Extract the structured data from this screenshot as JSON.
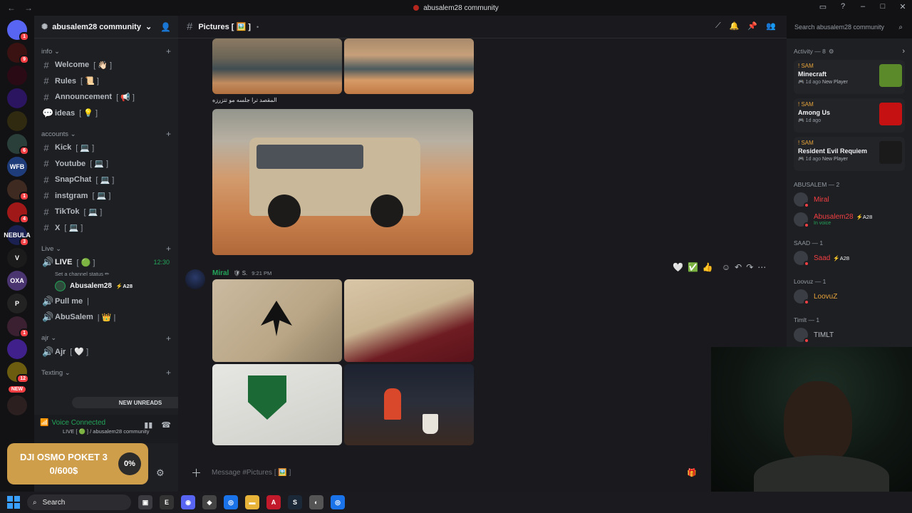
{
  "window": {
    "title": "abusalem28 community"
  },
  "server_list": {
    "new_label": "NEW",
    "servers": [
      {
        "letter": "",
        "color": "#5865f2",
        "badge": "1"
      },
      {
        "letter": "",
        "color": "#3a1212",
        "badge": "9"
      },
      {
        "letter": "",
        "color": "#2a0a14",
        "badge": ""
      },
      {
        "letter": "",
        "color": "#2b1460",
        "badge": ""
      },
      {
        "letter": "",
        "color": "#2f2a10",
        "badge": ""
      },
      {
        "letter": "",
        "color": "#2a3f3a",
        "badge": "6"
      },
      {
        "letter": "WFB",
        "color": "#1f3c7a",
        "badge": ""
      },
      {
        "letter": "",
        "color": "#3e2a20",
        "badge": "1"
      },
      {
        "letter": "",
        "color": "#a01818",
        "badge": "4"
      },
      {
        "letter": "NEBULA",
        "color": "#1a2050",
        "badge": "3"
      },
      {
        "letter": "V",
        "color": "#1b1b1b",
        "badge": ""
      },
      {
        "letter": "OXA",
        "color": "#4a3570",
        "badge": ""
      },
      {
        "letter": "P",
        "color": "#222",
        "badge": ""
      },
      {
        "letter": "",
        "color": "#3a2030",
        "badge": "1"
      },
      {
        "letter": "",
        "color": "#40208a",
        "badge": ""
      },
      {
        "letter": "",
        "color": "#6b5c10",
        "badge": "12"
      },
      {
        "letter": "",
        "color": "#2c1f1f",
        "badge": ""
      }
    ]
  },
  "guild": {
    "name": "abusalem28 community"
  },
  "categories": [
    {
      "name": "info",
      "channels": [
        {
          "name": "Welcome",
          "suffix": "[ 👋🏻 ]"
        },
        {
          "name": "Rules",
          "suffix": "[ 📜 ]"
        },
        {
          "name": "Announcement",
          "suffix": "[ 📢 ]"
        },
        {
          "name": "ideas",
          "suffix": "[ 💡 ]"
        }
      ]
    },
    {
      "name": "accounts",
      "channels": [
        {
          "name": "Kick",
          "suffix": "[ 💻 ]"
        },
        {
          "name": "Youtube",
          "suffix": "[ 💻 ]"
        },
        {
          "name": "SnapChat",
          "suffix": "[ 💻 ]"
        },
        {
          "name": "instgram",
          "suffix": "[ 💻 ]"
        },
        {
          "name": "TikTok",
          "suffix": "[ 💻 ]"
        },
        {
          "name": "X",
          "suffix": "[ 💻 ]"
        }
      ]
    }
  ],
  "live_category": {
    "name": "Live",
    "live_channel": {
      "name": "LIVE",
      "suffix": "[ 🟢 ]",
      "time": "12:30",
      "status": "Set a channel status ✏"
    },
    "voice_user": {
      "name": "Abusalem28",
      "tag": "⚡A28"
    },
    "channels": [
      {
        "name": "Pull me",
        "suffix": "|"
      },
      {
        "name": "AbuSalem",
        "suffix": "| 👑 |"
      }
    ]
  },
  "ajr_category": {
    "name": "ajr",
    "channels": [
      {
        "name": "Ajr",
        "suffix": "[ 🤍 ]"
      }
    ]
  },
  "texting_category": {
    "name": "Texting"
  },
  "new_unreads": "NEW UNREADS",
  "voice_panel": {
    "title": "Voice Connected",
    "subtitle": "LIVE [ 🟢 ] / abusalem28 community"
  },
  "goal": {
    "title": "DJI OSMO POKET 3",
    "amount": "0/600$",
    "percent_label": "0%",
    "progress": 0
  },
  "channel_header": {
    "name": "Pictures [ 🖼️ ]"
  },
  "search": {
    "placeholder": "Search abusalem28 community"
  },
  "messages": {
    "caption": "المقصد ترا جلسه مو تتزرزه",
    "author": "Miral",
    "author_badge": "🛡 S.",
    "timestamp": "9:21 PM"
  },
  "reactions": [
    "🤍",
    "✅",
    "👍"
  ],
  "composer": {
    "placeholder": "Message #Pictures [ 🖼️ ]"
  },
  "activity": {
    "header": "Activity — 8",
    "items": [
      {
        "user": "! SAM",
        "game": "Minecraft",
        "time": "1d ago",
        "note": "New Player",
        "color": "#5a8a2a"
      },
      {
        "user": "! SAM",
        "game": "Among Us",
        "time": "1d ago",
        "note": "",
        "color": "#c51111"
      },
      {
        "user": "! SAM",
        "game": "Resident Evil Requiem",
        "time": "1d ago",
        "note": "New Player",
        "color": "#1a1a1a"
      }
    ]
  },
  "member_groups": [
    {
      "title": "ABUSALEM — 2",
      "members": [
        {
          "name": "Miral",
          "name_color": "#f23f43",
          "tag": "",
          "sub": ""
        },
        {
          "name": "Abusalem28",
          "name_color": "#f23f43",
          "tag": "⚡A28",
          "sub": "In voice"
        }
      ]
    },
    {
      "title": "SAAD — 1",
      "members": [
        {
          "name": "Saad",
          "name_color": "#f23f43",
          "tag": "⚡A28",
          "sub": ""
        }
      ]
    },
    {
      "title": "Loovuz — 1",
      "members": [
        {
          "name": "LoovuZ",
          "name_color": "#e5a23a",
          "tag": "",
          "sub": ""
        }
      ]
    },
    {
      "title": "Timlt — 1",
      "members": [
        {
          "name": "TIMLT",
          "name_color": "#b5bac1",
          "tag": "",
          "sub": ""
        }
      ]
    }
  ],
  "taskbar": {
    "search_label": "Search"
  }
}
